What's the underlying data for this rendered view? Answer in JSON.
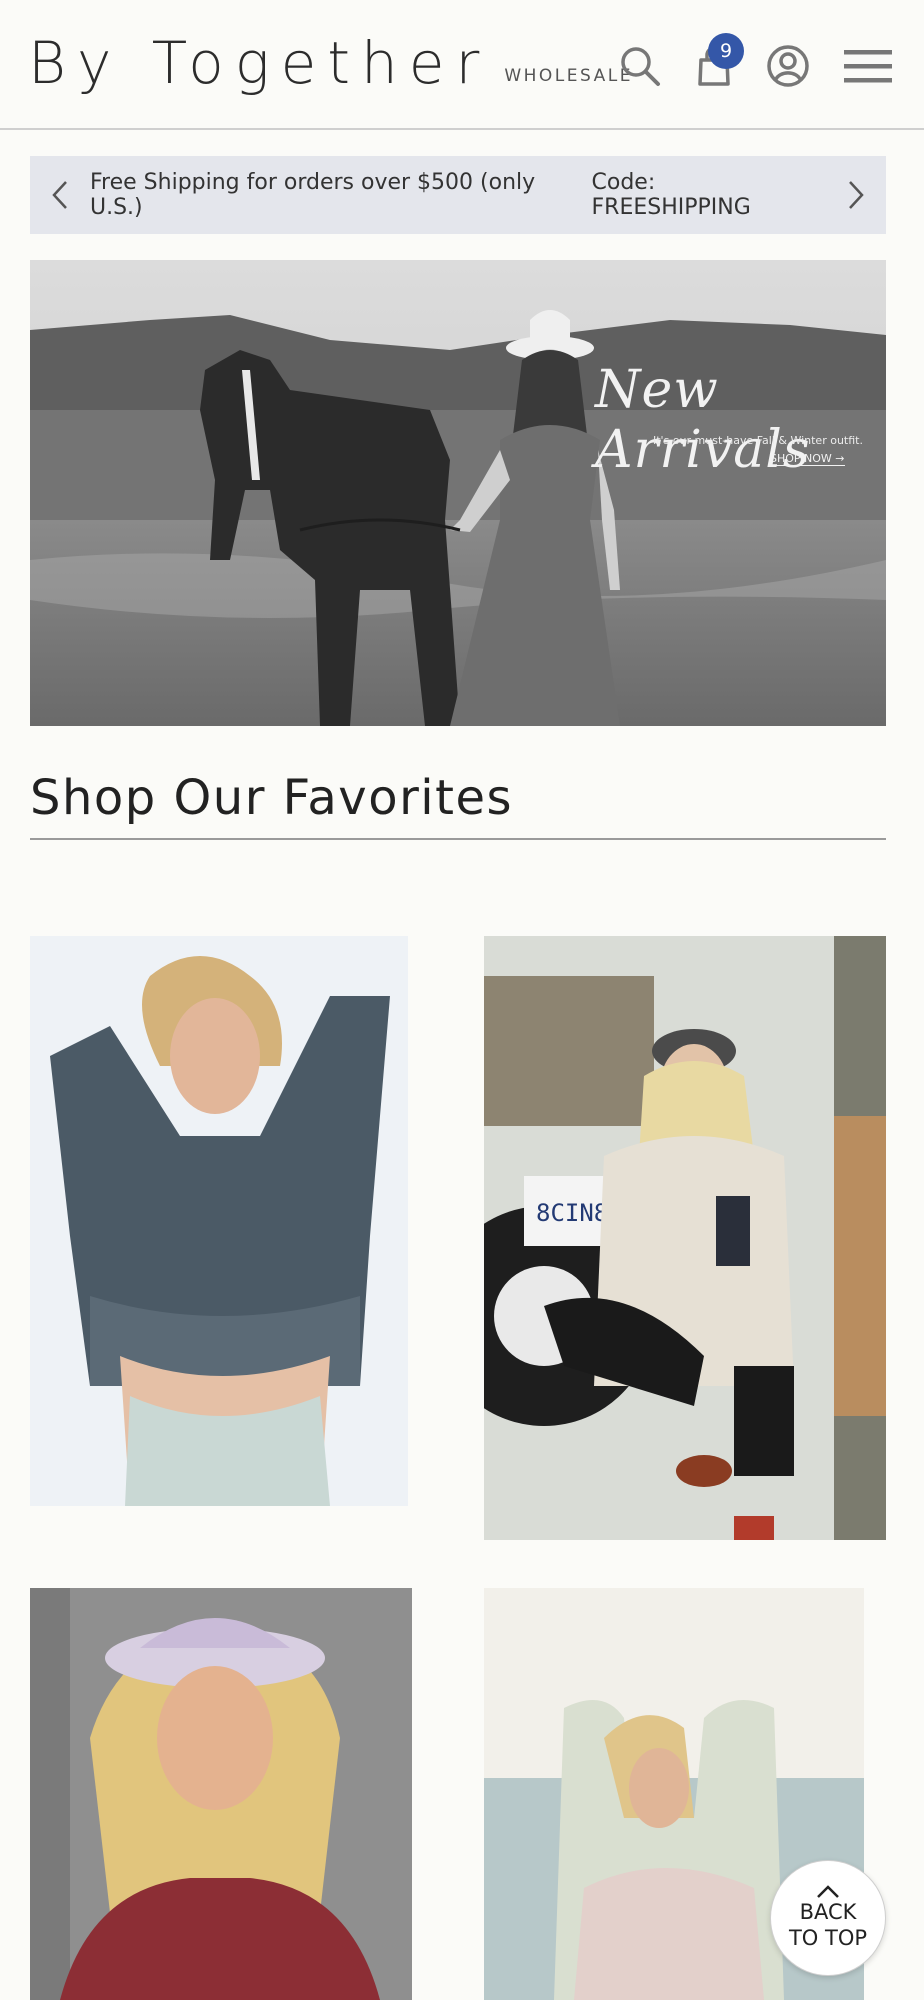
{
  "brand": {
    "name": "By Together",
    "tagline": "WHOLESALE"
  },
  "header": {
    "cart_count": "9",
    "icons": [
      "search-icon",
      "bag-icon",
      "account-icon",
      "hamburger-icon"
    ]
  },
  "promo": {
    "text": "Free Shipping for orders over $500 (only U.S.)",
    "code": "Code: FREESHIPPING",
    "icons": [
      "chevron-left-icon",
      "chevron-right-icon"
    ]
  },
  "hero": {
    "headline": "New Arrivals",
    "subline": "It's our must-have Fall & Winter outfit.",
    "cta": "SHOP NOW →"
  },
  "favorites": {
    "title": "Shop Our Favorites",
    "products": [
      {
        "name": "product-tile-crop-sweatshirt"
      },
      {
        "name": "product-tile-sherpa-jacket"
      },
      {
        "name": "product-tile-bucket-hat"
      },
      {
        "name": "product-tile-tie-dye-sweatshirt"
      }
    ]
  },
  "back_to_top": {
    "line1": "BACK",
    "line2": "TO TOP"
  },
  "colors": {
    "accent": "#3457a8",
    "promo_bg": "#e4e6ec",
    "page_bg": "#fbfbf8"
  }
}
